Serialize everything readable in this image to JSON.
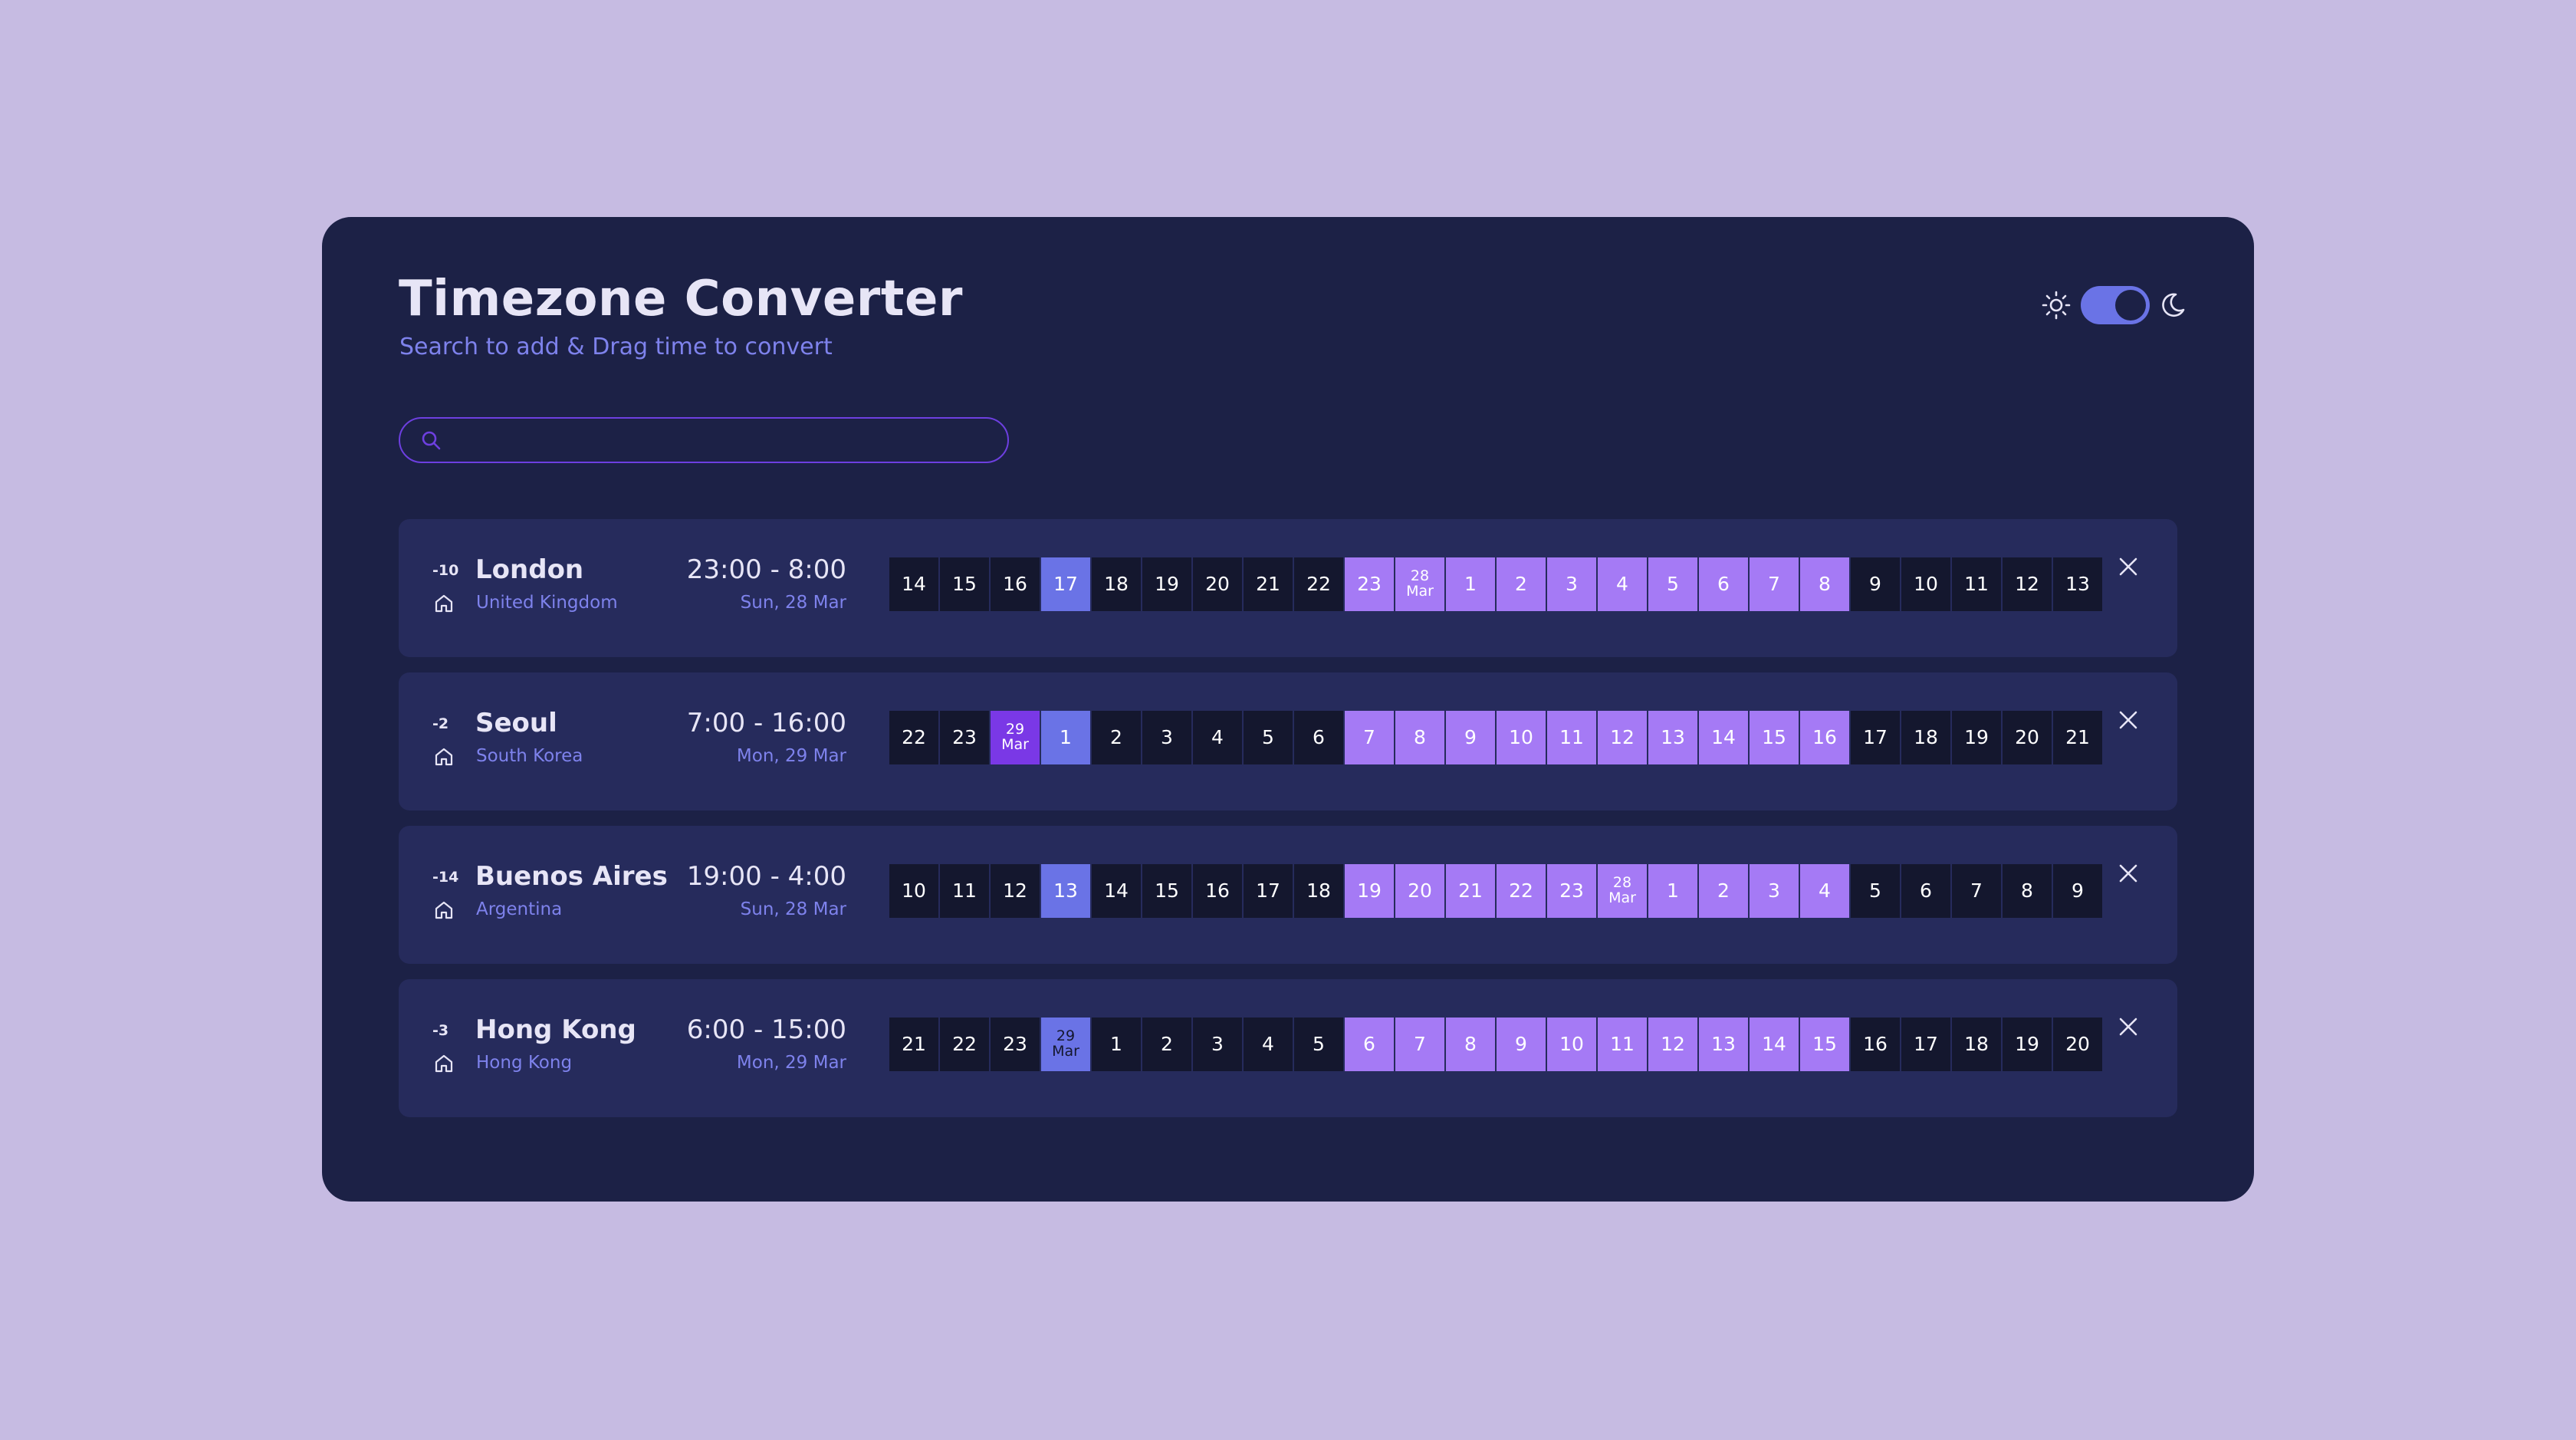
{
  "header": {
    "title": "Timezone Converter",
    "subtitle": "Search to add & Drag time to convert"
  },
  "search": {
    "placeholder": "",
    "value": ""
  },
  "theme": {
    "mode": "dark"
  },
  "colors": {
    "background": "#c6bbe2",
    "card": "#1c2146",
    "row": "#262b5c",
    "accent": "#6a73e6",
    "work_hours": "#a57af5",
    "day_start": "#7a38e6",
    "off_hours": "#14172e"
  },
  "timezones": [
    {
      "offset": "-10",
      "city": "London",
      "country": "United Kingdom",
      "range": "23:00 - 8:00",
      "date": "Sun, 28 Mar",
      "cells": [
        {
          "label": "14"
        },
        {
          "label": "15"
        },
        {
          "label": "16"
        },
        {
          "label": "17",
          "state": "current"
        },
        {
          "label": "18"
        },
        {
          "label": "19"
        },
        {
          "label": "20"
        },
        {
          "label": "21"
        },
        {
          "label": "22"
        },
        {
          "label": "23",
          "state": "selected"
        },
        {
          "day": "28",
          "month": "Mar",
          "state": "selected"
        },
        {
          "label": "1",
          "state": "selected"
        },
        {
          "label": "2",
          "state": "selected"
        },
        {
          "label": "3",
          "state": "selected"
        },
        {
          "label": "4",
          "state": "selected"
        },
        {
          "label": "5",
          "state": "selected"
        },
        {
          "label": "6",
          "state": "selected"
        },
        {
          "label": "7",
          "state": "selected"
        },
        {
          "label": "8",
          "state": "selected"
        },
        {
          "label": "9"
        },
        {
          "label": "10"
        },
        {
          "label": "11"
        },
        {
          "label": "12"
        },
        {
          "label": "13"
        }
      ]
    },
    {
      "offset": "-2",
      "city": "Seoul",
      "country": "South Korea",
      "range": "7:00 - 16:00",
      "date": "Mon, 29 Mar",
      "cells": [
        {
          "label": "22"
        },
        {
          "label": "23"
        },
        {
          "day": "29",
          "month": "Mar",
          "state": "day-start"
        },
        {
          "label": "1",
          "state": "current"
        },
        {
          "label": "2"
        },
        {
          "label": "3"
        },
        {
          "label": "4"
        },
        {
          "label": "5"
        },
        {
          "label": "6"
        },
        {
          "label": "7",
          "state": "selected"
        },
        {
          "label": "8",
          "state": "selected"
        },
        {
          "label": "9",
          "state": "selected"
        },
        {
          "label": "10",
          "state": "selected"
        },
        {
          "label": "11",
          "state": "selected"
        },
        {
          "label": "12",
          "state": "selected"
        },
        {
          "label": "13",
          "state": "selected"
        },
        {
          "label": "14",
          "state": "selected"
        },
        {
          "label": "15",
          "state": "selected"
        },
        {
          "label": "16",
          "state": "selected"
        },
        {
          "label": "17"
        },
        {
          "label": "18"
        },
        {
          "label": "19"
        },
        {
          "label": "20"
        },
        {
          "label": "21"
        }
      ]
    },
    {
      "offset": "-14",
      "city": "Buenos Aires",
      "country": "Argentina",
      "range": "19:00 - 4:00",
      "date": "Sun, 28 Mar",
      "cells": [
        {
          "label": "10"
        },
        {
          "label": "11"
        },
        {
          "label": "12"
        },
        {
          "label": "13",
          "state": "current"
        },
        {
          "label": "14"
        },
        {
          "label": "15"
        },
        {
          "label": "16"
        },
        {
          "label": "17"
        },
        {
          "label": "18"
        },
        {
          "label": "19",
          "state": "selected"
        },
        {
          "label": "20",
          "state": "selected"
        },
        {
          "label": "21",
          "state": "selected"
        },
        {
          "label": "22",
          "state": "selected"
        },
        {
          "label": "23",
          "state": "selected"
        },
        {
          "day": "28",
          "month": "Mar",
          "state": "selected"
        },
        {
          "label": "1",
          "state": "selected"
        },
        {
          "label": "2",
          "state": "selected"
        },
        {
          "label": "3",
          "state": "selected"
        },
        {
          "label": "4",
          "state": "selected"
        },
        {
          "label": "5"
        },
        {
          "label": "6"
        },
        {
          "label": "7"
        },
        {
          "label": "8"
        },
        {
          "label": "9"
        }
      ]
    },
    {
      "offset": "-3",
      "city": "Hong Kong",
      "country": "Hong Kong",
      "range": "6:00 - 15:00",
      "date": "Mon, 29 Mar",
      "cells": [
        {
          "label": "21"
        },
        {
          "label": "22"
        },
        {
          "label": "23"
        },
        {
          "day": "29",
          "month": "Mar",
          "state": "current"
        },
        {
          "label": "1"
        },
        {
          "label": "2"
        },
        {
          "label": "3"
        },
        {
          "label": "4"
        },
        {
          "label": "5"
        },
        {
          "label": "6",
          "state": "selected"
        },
        {
          "label": "7",
          "state": "selected"
        },
        {
          "label": "8",
          "state": "selected"
        },
        {
          "label": "9",
          "state": "selected"
        },
        {
          "label": "10",
          "state": "selected"
        },
        {
          "label": "11",
          "state": "selected"
        },
        {
          "label": "12",
          "state": "selected"
        },
        {
          "label": "13",
          "state": "selected"
        },
        {
          "label": "14",
          "state": "selected"
        },
        {
          "label": "15",
          "state": "selected"
        },
        {
          "label": "16"
        },
        {
          "label": "17"
        },
        {
          "label": "18"
        },
        {
          "label": "19"
        },
        {
          "label": "20"
        }
      ]
    }
  ]
}
